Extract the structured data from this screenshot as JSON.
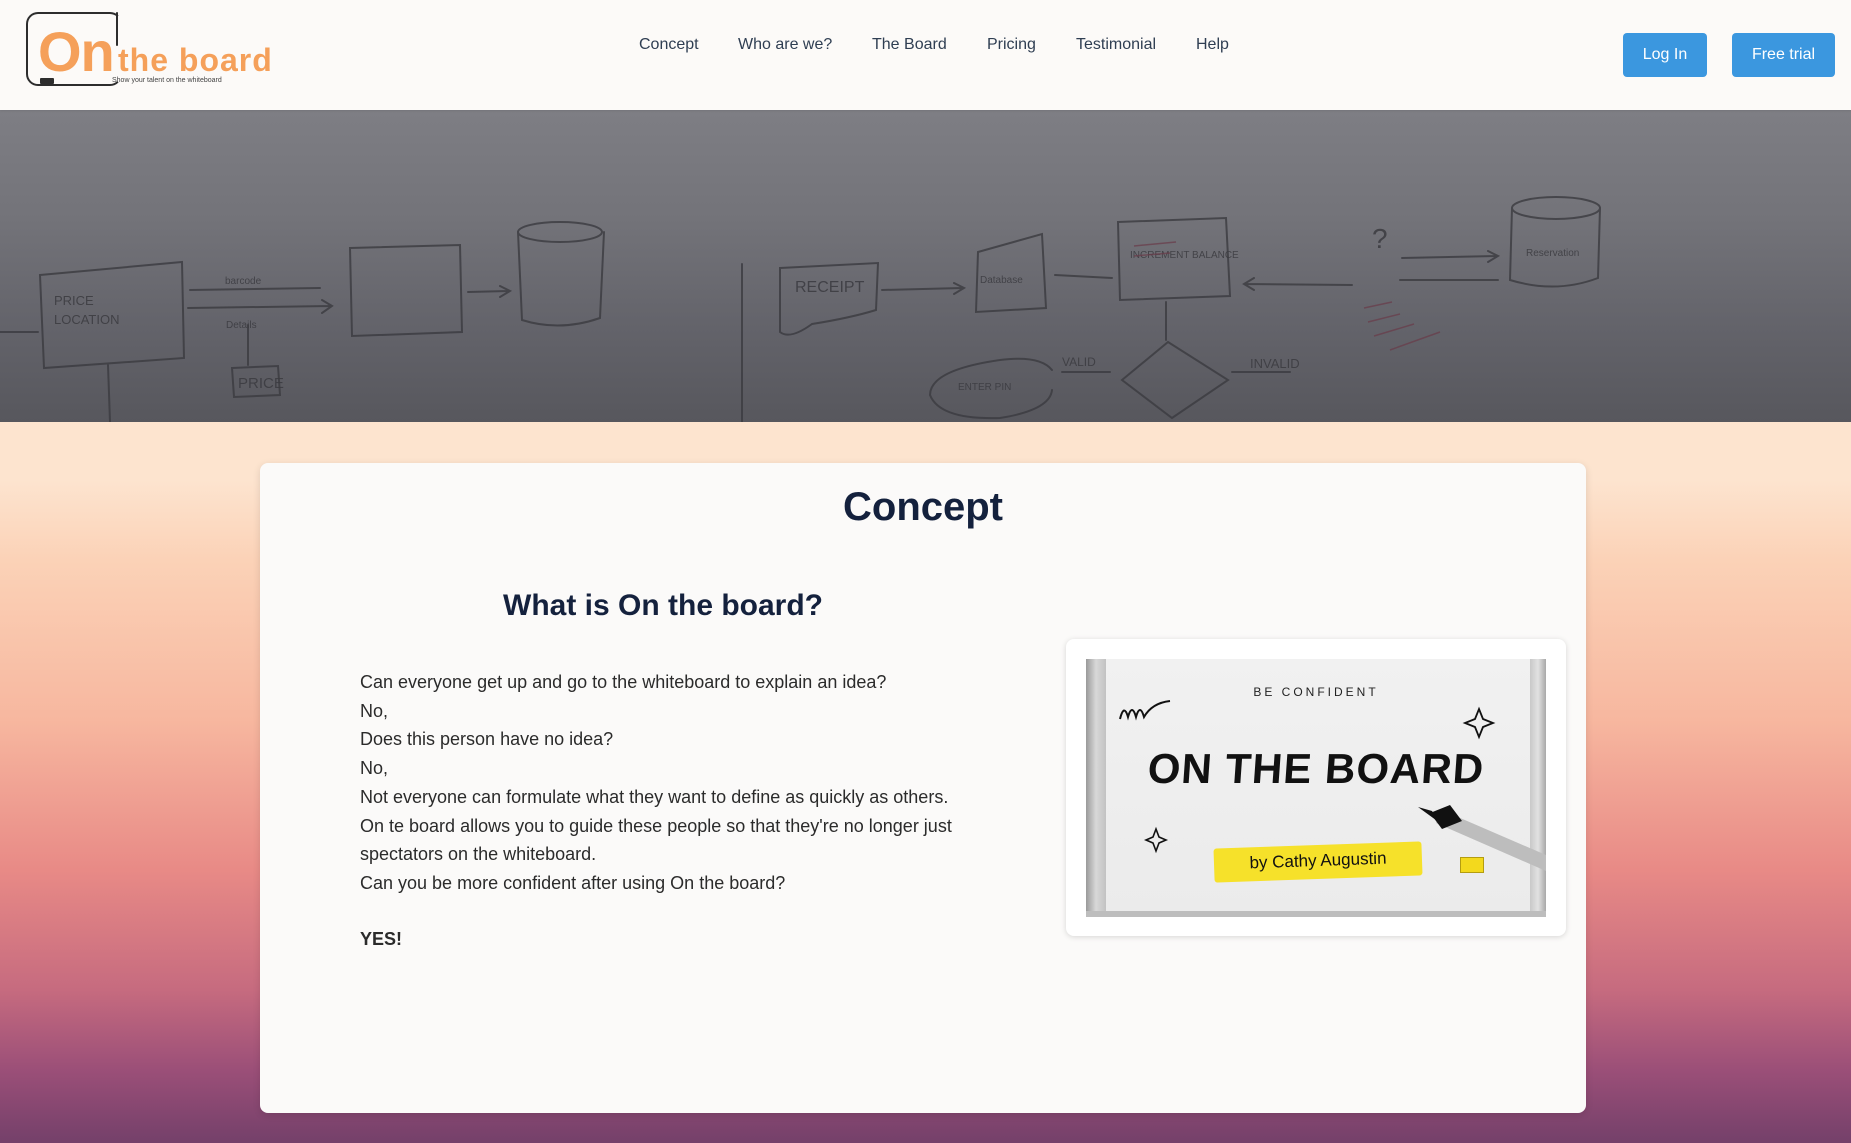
{
  "header": {
    "logo": {
      "main": "On",
      "sub": "the board",
      "tagline": "Show your talent on the whiteboard"
    },
    "nav": [
      {
        "label": "Concept"
      },
      {
        "label": "Who are we?"
      },
      {
        "label": "The Board"
      },
      {
        "label": "Pricing"
      },
      {
        "label": "Testimonial"
      },
      {
        "label": "Help"
      }
    ],
    "login_label": "Log In",
    "trial_label": "Free trial"
  },
  "hero": {
    "sketch_words": [
      "PRICE",
      "LOCATION",
      "barcode",
      "Details",
      "PRICE",
      "RECEIPT",
      "Database",
      "INCREMENT BALANCE",
      "VALID",
      "INVALID",
      "ENTER PIN",
      "?",
      "Reservation"
    ]
  },
  "concept": {
    "title": "Concept",
    "subtitle": "What is On the board?",
    "lines": [
      "Can everyone get up and go to the whiteboard to explain an idea?",
      "No,",
      "Does this person have no idea?",
      "No,",
      "Not everyone can formulate what they want to define as quickly as others.",
      "On te board allows you to guide these people so that they're no longer just",
      "spectators on the whiteboard.",
      "Can you be more confident after using On the board?"
    ],
    "answer": "YES!",
    "promo": {
      "small": "BE CONFIDENT",
      "big": "ON THE BOARD",
      "author": "by Cathy Augustin"
    }
  },
  "colors": {
    "accent": "#3b97df",
    "logo_orange": "#f5a05a",
    "title_navy": "#14213d"
  }
}
